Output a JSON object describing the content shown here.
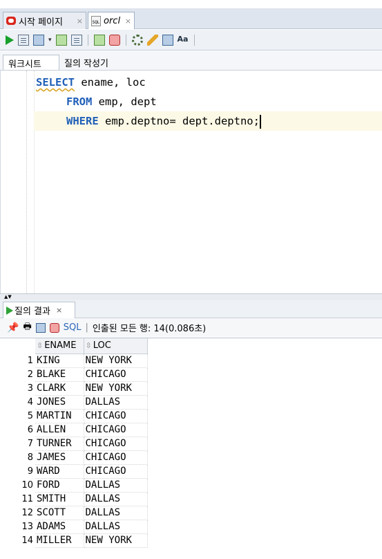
{
  "tabs": [
    {
      "label": "시작 페이지",
      "close": "×"
    },
    {
      "label": "orcl",
      "close": "×"
    }
  ],
  "toolbar": {
    "icons": [
      "run-statement-icon",
      "run-script-icon",
      "autotrace-icon",
      "explain-plan-icon",
      "sql-tuning-icon",
      "commit-icon",
      "rollback-icon",
      "unshared-sql-icon",
      "clear-icon",
      "history-icon",
      "format-icon"
    ],
    "dropdown": "▾"
  },
  "subtabs": {
    "worksheet": "워크시트",
    "query_builder": "질의 작성기"
  },
  "editor": {
    "lines": [
      {
        "kw": "SELECT",
        "rest": " ename, loc"
      },
      {
        "kw": "FROM",
        "rest": " emp, dept"
      },
      {
        "kw": "WHERE",
        "rest": " emp.deptno= dept.deptno;"
      }
    ]
  },
  "splitter": "▲▼",
  "results_tab": {
    "label": "질의 결과",
    "close": "×"
  },
  "results_toolbar": {
    "sql_label": "SQL",
    "separator": "|",
    "status": "인출된 모든 행: 14(0.086초)"
  },
  "grid": {
    "columns": [
      "ENAME",
      "LOC"
    ],
    "rows": [
      {
        "n": "1",
        "ename": "KING",
        "loc": "NEW YORK"
      },
      {
        "n": "2",
        "ename": "BLAKE",
        "loc": "CHICAGO"
      },
      {
        "n": "3",
        "ename": "CLARK",
        "loc": "NEW YORK"
      },
      {
        "n": "4",
        "ename": "JONES",
        "loc": "DALLAS"
      },
      {
        "n": "5",
        "ename": "MARTIN",
        "loc": "CHICAGO"
      },
      {
        "n": "6",
        "ename": "ALLEN",
        "loc": "CHICAGO"
      },
      {
        "n": "7",
        "ename": "TURNER",
        "loc": "CHICAGO"
      },
      {
        "n": "8",
        "ename": "JAMES",
        "loc": "CHICAGO"
      },
      {
        "n": "9",
        "ename": "WARD",
        "loc": "CHICAGO"
      },
      {
        "n": "10",
        "ename": "FORD",
        "loc": "DALLAS"
      },
      {
        "n": "11",
        "ename": "SMITH",
        "loc": "DALLAS"
      },
      {
        "n": "12",
        "ename": "SCOTT",
        "loc": "DALLAS"
      },
      {
        "n": "13",
        "ename": "ADAMS",
        "loc": "DALLAS"
      },
      {
        "n": "14",
        "ename": "MILLER",
        "loc": "NEW YORK"
      }
    ]
  }
}
